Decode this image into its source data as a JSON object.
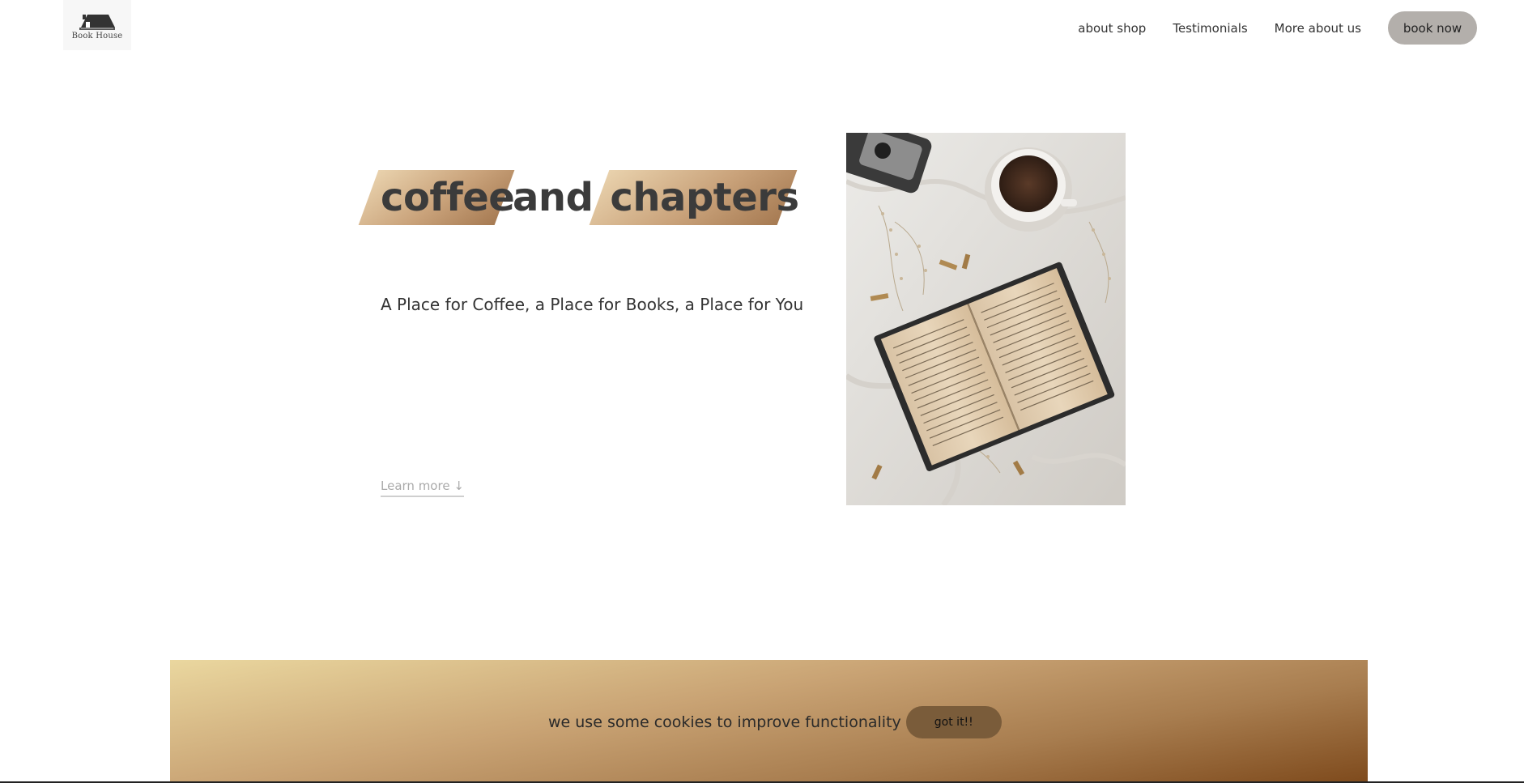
{
  "header": {
    "logo_text": "Book House",
    "nav": [
      "about shop",
      "Testimonials",
      "More about us"
    ],
    "cta_label": "book now"
  },
  "hero": {
    "title_words": [
      "coffee",
      "and",
      "chapters"
    ],
    "tagline": "A Place for Coffee, a Place for Books, a Place for You",
    "learn_more": "Learn more ↓",
    "image_icon": "coffee-book-photo"
  },
  "cookie": {
    "text": "we use some cookies to improve functionality",
    "button_label": "got it!!"
  },
  "colors": {
    "accent_gold": "#c9a27a",
    "cta_gray": "#b3afab",
    "cookie_button": "#7a5c3a"
  }
}
